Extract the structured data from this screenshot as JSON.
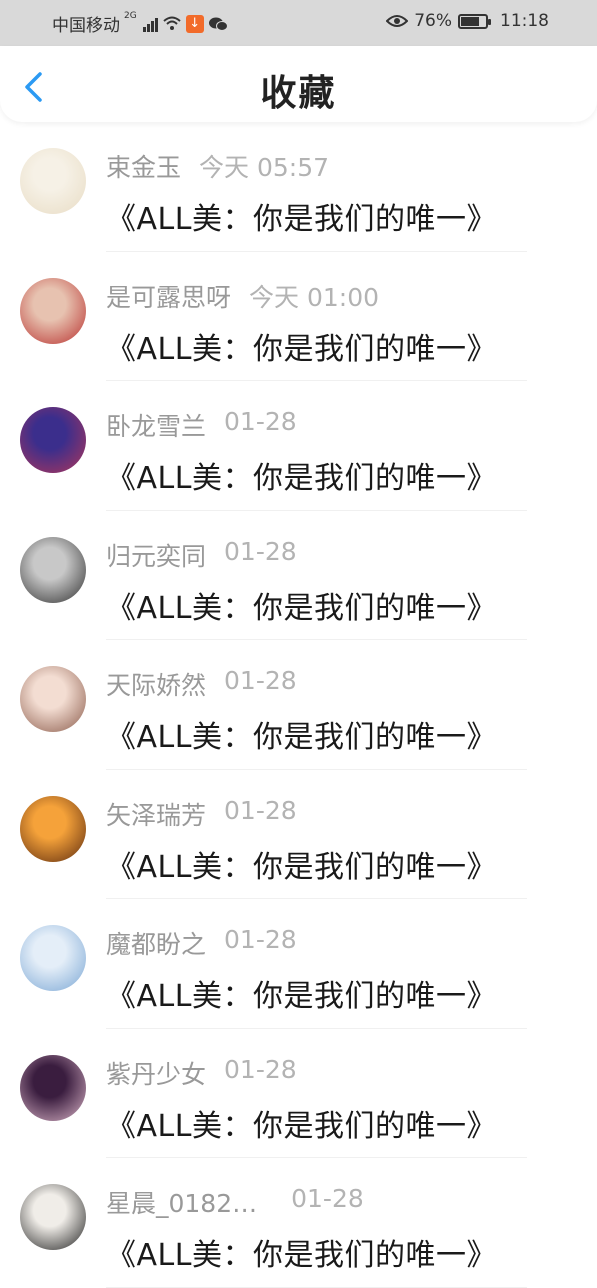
{
  "status_bar": {
    "carrier": "中国移动",
    "network": "2G",
    "battery": "76%",
    "battery_level": 0.76,
    "time": "11:18",
    "background": "#d9d9d9"
  },
  "header": {
    "title": "收藏",
    "back_icon": "chevron-left-icon",
    "accent": "#2b9af3"
  },
  "items": [
    {
      "name": "束金玉",
      "time": "今天 05:57",
      "content": "《ALL美：你是我们的唯一》",
      "avatar_colors": [
        "#f6f1e6",
        "#e8dcc4"
      ]
    },
    {
      "name": "是可露思呀",
      "time": "今天 01:00",
      "content": "《ALL美：你是我们的唯一》",
      "avatar_colors": [
        "#e7c2b0",
        "#b8302e"
      ]
    },
    {
      "name": "卧龙雪兰",
      "time": "01-28",
      "content": "《ALL美：你是我们的唯一》",
      "avatar_colors": [
        "#3b2e8c",
        "#b0365a"
      ]
    },
    {
      "name": "归元奕同",
      "time": "01-28",
      "content": "《ALL美：你是我们的唯一》",
      "avatar_colors": [
        "#c8c8c8",
        "#2f2f2f"
      ]
    },
    {
      "name": "天际娇然",
      "time": "01-28",
      "content": "《ALL美：你是我们的唯一》",
      "avatar_colors": [
        "#f3ddd2",
        "#8a5a4a"
      ]
    },
    {
      "name": "矢泽瑞芳",
      "time": "01-28",
      "content": "《ALL美：你是我们的唯一》",
      "avatar_colors": [
        "#f5a23a",
        "#5c2a0e"
      ]
    },
    {
      "name": "魔都盼之",
      "time": "01-28",
      "content": "《ALL美：你是我们的唯一》",
      "avatar_colors": [
        "#e4eef8",
        "#7aa6d4"
      ]
    },
    {
      "name": "紫丹少女",
      "time": "01-28",
      "content": "《ALL美：你是我们的唯一》",
      "avatar_colors": [
        "#3a1d3f",
        "#d9b3c6"
      ]
    },
    {
      "name": "星晨_0182…",
      "time": "01-28",
      "content": "《ALL美：你是我们的唯一》",
      "avatar_colors": [
        "#f0ede8",
        "#1f1f1f"
      ]
    }
  ]
}
